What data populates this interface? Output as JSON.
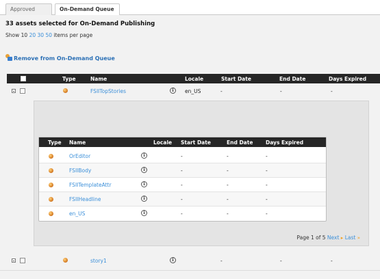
{
  "tabs": [
    {
      "label": "Approved Assets",
      "active": false
    },
    {
      "label": "On-Demand Queue",
      "active": true
    }
  ],
  "selection_summary": "33 assets selected for On-Demand Publishing",
  "per_page": {
    "prefix": "Show 10",
    "opt_20": "20",
    "opt_30": "30",
    "opt_50": "50",
    "suffix": "items per page"
  },
  "remove_label": "Remove from On-Demand Queue",
  "main_table": {
    "headers": {
      "type": "Type",
      "name": "Name",
      "locale": "Locale",
      "start": "Start Date",
      "end": "End Date",
      "expired": "Days Expired"
    },
    "rows": [
      {
        "name": "FSIITopStories",
        "locale": "en_US",
        "start": "-",
        "end": "-",
        "expired": "-"
      },
      {
        "name": "story1",
        "locale": "-",
        "start": "-",
        "end": "-",
        "expired": "-"
      }
    ]
  },
  "nested_table": {
    "headers": {
      "type": "Type",
      "name": "Name",
      "locale": "Locale",
      "start": "Start Date",
      "end": "End Date",
      "expired": "Days Expired"
    },
    "rows": [
      {
        "name": "OrEditor",
        "locale": "",
        "start": "-",
        "end": "-",
        "expired": "-"
      },
      {
        "name": "FSIIBody",
        "locale": "",
        "start": "-",
        "end": "-",
        "expired": "-"
      },
      {
        "name": "FSIITemplateAttr",
        "locale": "",
        "start": "-",
        "end": "-",
        "expired": "-"
      },
      {
        "name": "FSIIHeadline",
        "locale": "",
        "start": "-",
        "end": "-",
        "expired": "-"
      },
      {
        "name": "en_US",
        "locale": "",
        "start": "-",
        "end": "-",
        "expired": "-"
      }
    ],
    "pager": {
      "page_text": "Page 1 of 5",
      "next": "Next",
      "last": "Last"
    }
  },
  "colors": {
    "header_bg": "#262626",
    "link": "#3b8fd9",
    "accent_arrow": "#f0a020"
  },
  "icons": {
    "asset": "asset-sphere-icon",
    "info": "info-icon",
    "expand": "expander-icon",
    "remove": "remove-queue-icon"
  }
}
